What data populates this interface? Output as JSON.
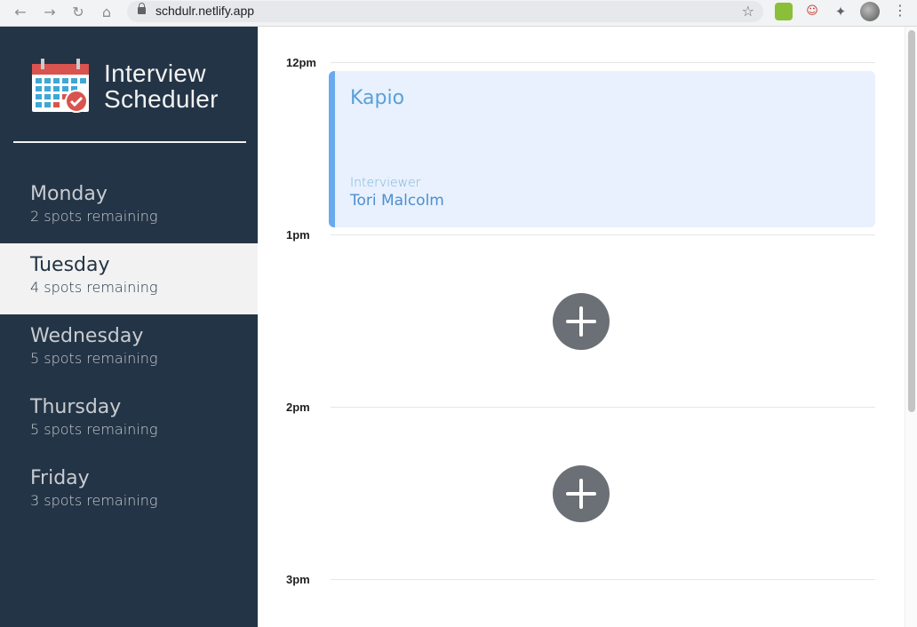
{
  "browser": {
    "url": "schdulr.netlify.app",
    "icons": [
      "back-arrow-icon",
      "forward-arrow-icon",
      "reload-icon",
      "home-icon",
      "lock-icon",
      "bookmark-star-icon",
      "extensions-icon",
      "profile-avatar",
      "menu-kebab-icon"
    ]
  },
  "sidebar": {
    "brand_line1": "Interview",
    "brand_line2": "Scheduler",
    "days": [
      {
        "name": "Monday",
        "spots": "2 spots remaining",
        "selected": false
      },
      {
        "name": "Tuesday",
        "spots": "4 spots remaining",
        "selected": true
      },
      {
        "name": "Wednesday",
        "spots": "5 spots remaining",
        "selected": false
      },
      {
        "name": "Thursday",
        "spots": "5 spots remaining",
        "selected": false
      },
      {
        "name": "Friday",
        "spots": "3 spots remaining",
        "selected": false
      }
    ]
  },
  "schedule": {
    "times": [
      "12pm",
      "1pm",
      "2pm",
      "3pm"
    ],
    "appointment": {
      "student": "Kapio",
      "interviewer_label": "Interviewer",
      "interviewer": "Tori Malcolm"
    }
  },
  "colors": {
    "sidebar_bg": "#233446",
    "selected_bg": "#f2f2f2",
    "appointment_bg": "#e8f1fd",
    "accent_blue": "#6ba9ef",
    "add_button": "#6b6f76"
  }
}
